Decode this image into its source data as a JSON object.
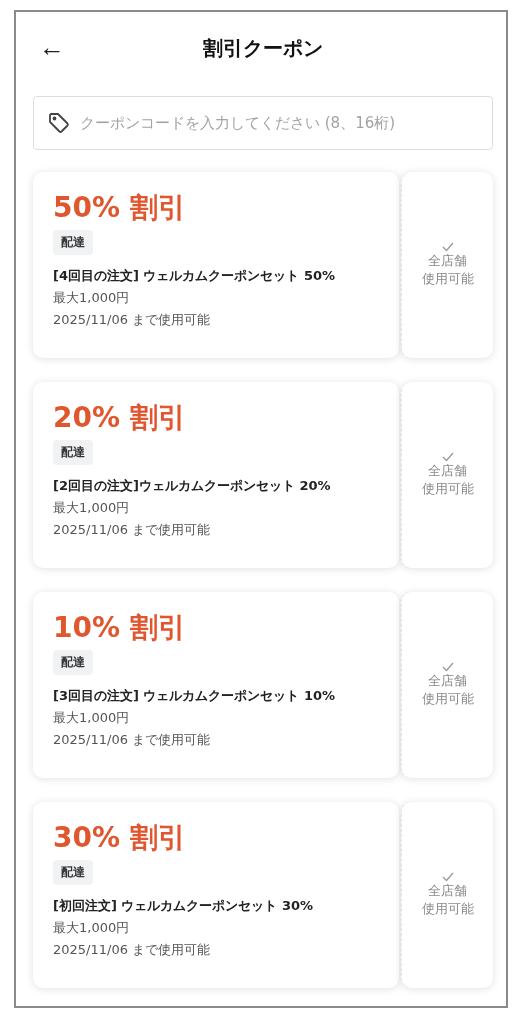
{
  "header": {
    "back": "←",
    "title": "割引クーポン"
  },
  "search": {
    "placeholder": "クーポンコードを入力してください (8、16桁)"
  },
  "coupons": [
    {
      "discount": "50% 割引",
      "tag": "配達",
      "name": "[4回目の注文] ウェルカムクーポンセット 50%",
      "max": "最大1,000円",
      "valid": "2025/11/06 まで使用可能",
      "scope": [
        "全店舗",
        "使用可能"
      ]
    },
    {
      "discount": "20% 割引",
      "tag": "配達",
      "name": "[2回目の注文]ウェルカムクーポンセット 20%",
      "max": "最大1,000円",
      "valid": "2025/11/06 まで使用可能",
      "scope": [
        "全店舗",
        "使用可能"
      ]
    },
    {
      "discount": "10% 割引",
      "tag": "配達",
      "name": "[3回目の注文] ウェルカムクーポンセット 10%",
      "max": "最大1,000円",
      "valid": "2025/11/06 まで使用可能",
      "scope": [
        "全店舗",
        "使用可能"
      ]
    },
    {
      "discount": "30% 割引",
      "tag": "配達",
      "name": "[初回注文] ウェルカムクーポンセット 30%",
      "max": "最大1,000円",
      "valid": "2025/11/06 まで使用可能",
      "scope": [
        "全店舗",
        "使用可能"
      ]
    }
  ]
}
